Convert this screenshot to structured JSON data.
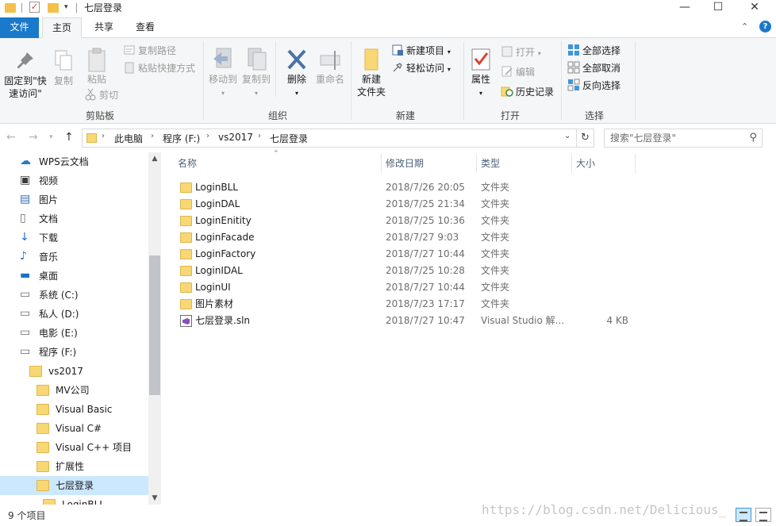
{
  "window": {
    "title": "七层登录",
    "min_icon": "minimize-icon",
    "max_icon": "maximize-icon",
    "close_icon": "close-icon"
  },
  "tabs": [
    {
      "label": "文件",
      "active": false
    },
    {
      "label": "主页",
      "active": true
    },
    {
      "label": "共享",
      "active": false
    },
    {
      "label": "查看",
      "active": false
    }
  ],
  "ribbon": {
    "clipboard": {
      "group_label": "剪贴板",
      "pin_label_1": "固定到\"快",
      "pin_label_2": "速访问\"",
      "copy_label": "复制",
      "paste_label": "粘贴",
      "copy_path_label": "复制路径",
      "paste_shortcut_label": "粘贴快捷方式",
      "cut_label": "剪切"
    },
    "organize": {
      "group_label": "组织",
      "move_to_label": "移动到",
      "copy_to_label": "复制到",
      "delete_label": "删除",
      "rename_label": "重命名"
    },
    "new": {
      "group_label": "新建",
      "new_folder_label_1": "新建",
      "new_folder_label_2": "文件夹",
      "new_item_label": "新建项目",
      "easy_access_label": "轻松访问"
    },
    "open": {
      "group_label": "打开",
      "properties_label": "属性",
      "open_label": "打开",
      "edit_label": "编辑",
      "history_label": "历史记录"
    },
    "select": {
      "group_label": "选择",
      "select_all_label": "全部选择",
      "select_none_label": "全部取消",
      "invert_label": "反向选择"
    }
  },
  "address": {
    "crumbs": [
      "此电脑",
      "程序 (F:)",
      "vs2017",
      "七层登录"
    ]
  },
  "search": {
    "placeholder": "搜索\"七层登录\""
  },
  "nav_items": [
    {
      "label": "WPS云文档",
      "icon": "cloud-icon",
      "indent": 0,
      "selected": false
    },
    {
      "label": "视频",
      "icon": "video-icon",
      "indent": 0,
      "selected": false
    },
    {
      "label": "图片",
      "icon": "picture-icon",
      "indent": 0,
      "selected": false
    },
    {
      "label": "文档",
      "icon": "document-icon",
      "indent": 0,
      "selected": false
    },
    {
      "label": "下载",
      "icon": "download-icon",
      "indent": 0,
      "selected": false
    },
    {
      "label": "音乐",
      "icon": "music-icon",
      "indent": 0,
      "selected": false
    },
    {
      "label": "桌面",
      "icon": "desktop-icon",
      "indent": 0,
      "selected": false
    },
    {
      "label": "系统 (C:)",
      "icon": "drive-icon",
      "indent": 0,
      "selected": false
    },
    {
      "label": "私人 (D:)",
      "icon": "drive-icon",
      "indent": 0,
      "selected": false
    },
    {
      "label": "电影 (E:)",
      "icon": "drive-icon",
      "indent": 0,
      "selected": false
    },
    {
      "label": "程序 (F:)",
      "icon": "drive-icon",
      "indent": 0,
      "selected": false
    },
    {
      "label": "vs2017",
      "icon": "folder-icon",
      "indent": 1,
      "selected": false
    },
    {
      "label": "MV公司",
      "icon": "folder-icon",
      "indent": 2,
      "selected": false
    },
    {
      "label": "Visual Basic",
      "icon": "folder-icon",
      "indent": 2,
      "selected": false
    },
    {
      "label": "Visual C#",
      "icon": "folder-icon",
      "indent": 2,
      "selected": false
    },
    {
      "label": "Visual C++ 项目",
      "icon": "folder-icon",
      "indent": 2,
      "selected": false
    },
    {
      "label": "扩展性",
      "icon": "folder-icon",
      "indent": 2,
      "selected": false
    },
    {
      "label": "七层登录",
      "icon": "folder-icon",
      "indent": 2,
      "selected": true
    },
    {
      "label": "LoginBLL",
      "icon": "folder-icon",
      "indent": 3,
      "selected": false
    }
  ],
  "columns": {
    "name": "名称",
    "date": "修改日期",
    "type": "类型",
    "size": "大小"
  },
  "files": [
    {
      "name": "LoginBLL",
      "date": "2018/7/26 20:05",
      "type": "文件夹",
      "size": "",
      "icon": "folder-icon"
    },
    {
      "name": "LoginDAL",
      "date": "2018/7/25 21:34",
      "type": "文件夹",
      "size": "",
      "icon": "folder-icon"
    },
    {
      "name": "LoginEnitity",
      "date": "2018/7/25 10:36",
      "type": "文件夹",
      "size": "",
      "icon": "folder-icon"
    },
    {
      "name": "LoginFacade",
      "date": "2018/7/27 9:03",
      "type": "文件夹",
      "size": "",
      "icon": "folder-icon"
    },
    {
      "name": "LoginFactory",
      "date": "2018/7/27 10:44",
      "type": "文件夹",
      "size": "",
      "icon": "folder-icon"
    },
    {
      "name": "LoginIDAL",
      "date": "2018/7/25 10:28",
      "type": "文件夹",
      "size": "",
      "icon": "folder-icon"
    },
    {
      "name": "LoginUI",
      "date": "2018/7/27 10:44",
      "type": "文件夹",
      "size": "",
      "icon": "folder-icon"
    },
    {
      "name": "图片素材",
      "date": "2018/7/23 17:17",
      "type": "文件夹",
      "size": "",
      "icon": "folder-icon"
    },
    {
      "name": "七层登录.sln",
      "date": "2018/7/27 10:47",
      "type": "Visual Studio 解...",
      "size": "4 KB",
      "icon": "visual-studio-solution-icon"
    }
  ],
  "status": {
    "item_count": "9 个项目"
  },
  "watermark": "https://blog.csdn.net/Delicious_",
  "colors": {
    "accent": "#1979ca",
    "selected_bg": "#cce8ff",
    "folder": "#f8d775"
  }
}
